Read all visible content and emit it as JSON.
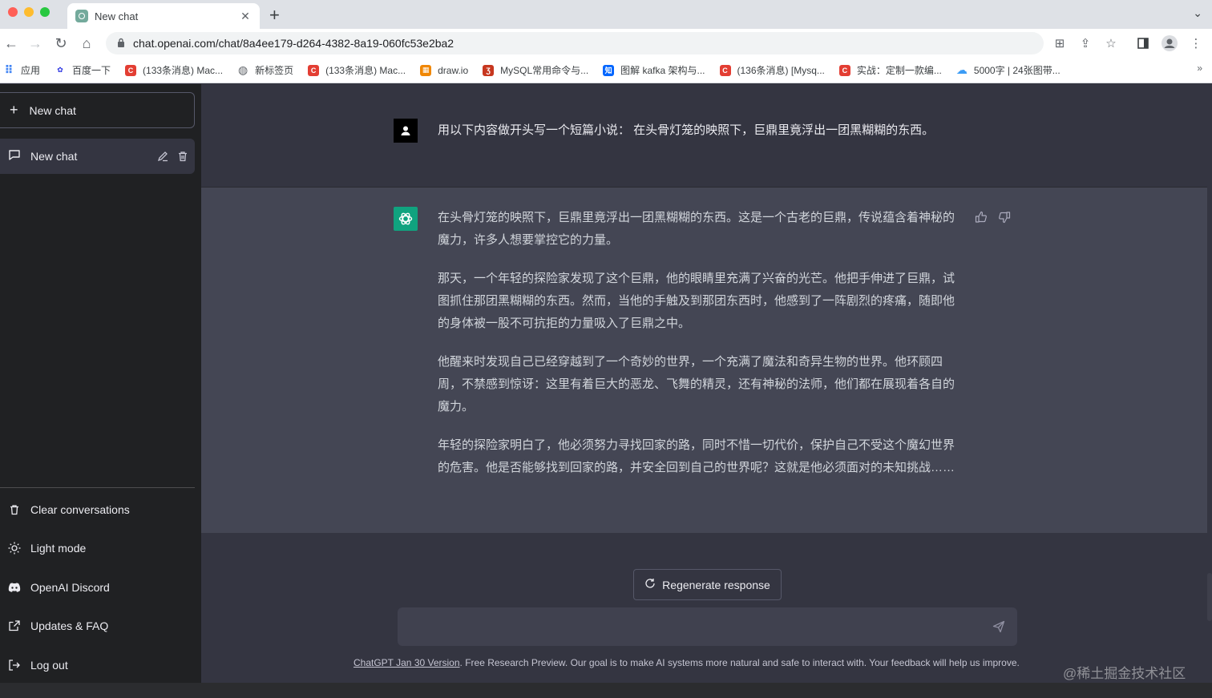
{
  "browser": {
    "tab_title": "New chat",
    "url": "chat.openai.com/chat/8a4ee179-d264-4382-8a19-060fc53e2ba2",
    "bookmarks": [
      {
        "label": "应用",
        "icon": "apps-grid-icon",
        "color": "#4285f4"
      },
      {
        "label": "百度一下",
        "icon": "baidu-paw-icon",
        "color": "#2932e1"
      },
      {
        "label": "(133条消息) Mac...",
        "icon": "csdn-icon",
        "color": "#e33e33"
      },
      {
        "label": "新标签页",
        "icon": "globe-icon",
        "color": "#5f6368"
      },
      {
        "label": "(133条消息) Mac...",
        "icon": "csdn-icon",
        "color": "#e33e33"
      },
      {
        "label": "draw.io",
        "icon": "drawio-icon",
        "color": "#f08705"
      },
      {
        "label": "MySQL常用命令与...",
        "icon": "mysql-icon",
        "color": "#c7371f"
      },
      {
        "label": "图解 kafka 架构与...",
        "icon": "zhihu-icon",
        "color": "#0066ff"
      },
      {
        "label": "(136条消息) [Mysq...",
        "icon": "csdn-icon",
        "color": "#e33e33"
      },
      {
        "label": "实战：定制一款编...",
        "icon": "csdn-icon",
        "color": "#e33e33"
      },
      {
        "label": "5000字 | 24张图带...",
        "icon": "cloud-icon",
        "color": "#3b9cf5"
      }
    ]
  },
  "sidebar": {
    "new_chat_label": "New chat",
    "conversations": [
      {
        "label": "New chat"
      }
    ],
    "menu": [
      {
        "label": "Clear conversations",
        "icon": "trash-icon"
      },
      {
        "label": "Light mode",
        "icon": "sun-icon"
      },
      {
        "label": "OpenAI Discord",
        "icon": "discord-icon"
      },
      {
        "label": "Updates & FAQ",
        "icon": "external-link-icon"
      },
      {
        "label": "Log out",
        "icon": "logout-icon"
      }
    ]
  },
  "conversation": {
    "user_message": "用以下内容做开头写一个短篇小说：  在头骨灯笼的映照下，巨鼎里竟浮出一团黑糊糊的东西。",
    "assistant_paragraphs": [
      "在头骨灯笼的映照下，巨鼎里竟浮出一团黑糊糊的东西。这是一个古老的巨鼎，传说蕴含着神秘的魔力，许多人想要掌控它的力量。",
      "那天，一个年轻的探险家发现了这个巨鼎，他的眼睛里充满了兴奋的光芒。他把手伸进了巨鼎，试图抓住那团黑糊糊的东西。然而，当他的手触及到那团东西时，他感到了一阵剧烈的疼痛，随即他的身体被一股不可抗拒的力量吸入了巨鼎之中。",
      "他醒来时发现自己已经穿越到了一个奇妙的世界，一个充满了魔法和奇异生物的世界。他环顾四周，不禁感到惊讶：这里有着巨大的恶龙、飞舞的精灵，还有神秘的法师，他们都在展现着各自的魔力。",
      "年轻的探险家明白了，他必须努力寻找回家的路，同时不惜一切代价，保护自己不受这个魔幻世界的危害。他是否能够找到回家的路，并安全回到自己的世界呢？这就是他必须面对的未知挑战……"
    ]
  },
  "composer": {
    "regenerate_label": "Regenerate response",
    "placeholder": ""
  },
  "footer": {
    "version_link": "ChatGPT Jan 30 Version",
    "note": ". Free Research Preview. Our goal is to make AI systems more natural and safe to interact with. Your feedback will help us improve."
  },
  "watermark": "@稀土掘金技术社区",
  "colors": {
    "sidebar_bg": "#202123",
    "main_bg": "#343541",
    "assistant_bg": "#444654",
    "brand_green": "#10a37f"
  }
}
